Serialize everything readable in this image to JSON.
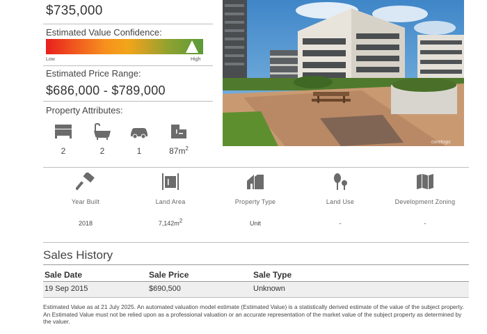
{
  "valuation": {
    "estimated_value": "$735,000",
    "confidence_label": "Estimated Value Confidence:",
    "confidence_low": "Low",
    "confidence_high": "High",
    "confidence_level": 0.93,
    "price_range_label": "Estimated Price Range:",
    "price_range": "$686,000 - $789,000"
  },
  "attributes": {
    "label": "Property Attributes:",
    "bedrooms": "2",
    "bathrooms": "2",
    "car_spaces": "1",
    "floor_area": "87m",
    "floor_area_sup": "2",
    "icons": [
      "bed-icon",
      "bath-icon",
      "car-icon",
      "floor-area-icon"
    ]
  },
  "details": [
    {
      "icon": "hammer-icon",
      "label": "Year Built",
      "value": "2018"
    },
    {
      "icon": "land-area-icon",
      "label": "Land Area",
      "value": "7,142m",
      "sup": "2"
    },
    {
      "icon": "house-icon",
      "label": "Property Type",
      "value": "Unit"
    },
    {
      "icon": "tree-icon",
      "label": "Land Use",
      "value": "-"
    },
    {
      "icon": "map-icon",
      "label": "Development Zoning",
      "value": "-"
    }
  ],
  "photo": {
    "watermark": "corelogic"
  },
  "sales_history": {
    "title": "Sales History",
    "columns": [
      "Sale Date",
      "Sale Price",
      "Sale Type"
    ],
    "rows": [
      {
        "date": "19 Sep 2015",
        "price": "$690,500",
        "type": "Unknown"
      }
    ]
  },
  "disclaimer": "Estimated Value as at 21 July 2025. An automated valuation model estimate (Estimated Value) is a statistically derived estimate of the value of the subject property. An Estimated Value must not be relied upon as a professional valuation or an accurate representation of the market value of the subject property as determined by the valuer.",
  "colors": {
    "icon": "#6b6b6b",
    "divider": "#bdbdbd",
    "row_bg": "#efefef"
  }
}
